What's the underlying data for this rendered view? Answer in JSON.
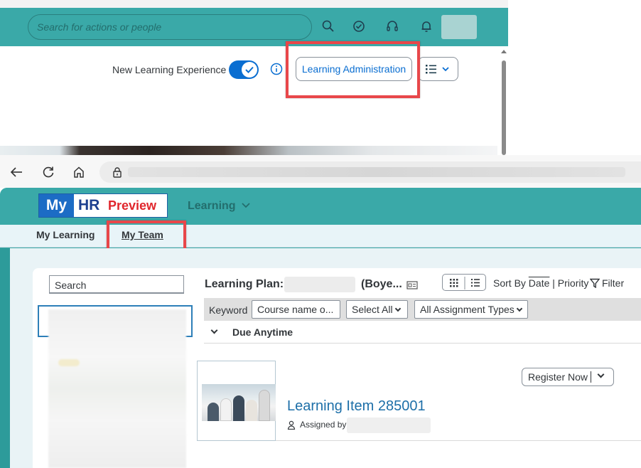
{
  "top_window": {
    "header": {
      "search_placeholder": "Search for actions or people",
      "icons": [
        "search-icon",
        "checkmark-circle-icon",
        "headset-icon",
        "bell-icon"
      ]
    },
    "toolbar": {
      "new_experience_label": "New Learning Experience",
      "new_experience_enabled": true,
      "learning_admin_button": "Learning Administration",
      "list_menu_icon": "list-icon"
    }
  },
  "bottom_window": {
    "browser": {
      "icons": [
        "back-arrow-icon",
        "reload-icon",
        "home-icon",
        "lock-icon"
      ]
    },
    "app_header": {
      "logo": {
        "my": "My",
        "hr": "HR",
        "preview": "Preview"
      },
      "menu_label": "Learning"
    },
    "subnav": {
      "tabs": [
        {
          "label": "My Learning",
          "active": false
        },
        {
          "label": "My Team",
          "active": true
        }
      ]
    },
    "learning_plan": {
      "search_label": "Search",
      "title_prefix": "Learning Plan:",
      "title_suffix": "(Boye...",
      "sort_label": "Sort By",
      "sort_date": "Date",
      "sort_separator": "|",
      "sort_priority": "Priority",
      "filter_label": "Filter",
      "toolbar": {
        "keyword_label": "Keyword",
        "keyword_placeholder": "Course name o...",
        "select_all": "Select All",
        "assignment_types": "All Assignment Types"
      },
      "group_label": "Due Anytime",
      "items": [
        {
          "title": "Learning Item 285001",
          "assigned_label": "Assigned by",
          "register_button": "Register Now"
        }
      ]
    }
  },
  "colors": {
    "header_teal": "#3aa9a8",
    "accent_blue": "#0a6ed1",
    "highlight_red": "#e8474a",
    "logo_blue": "#1c6cc5",
    "logo_red": "#e0262c"
  }
}
